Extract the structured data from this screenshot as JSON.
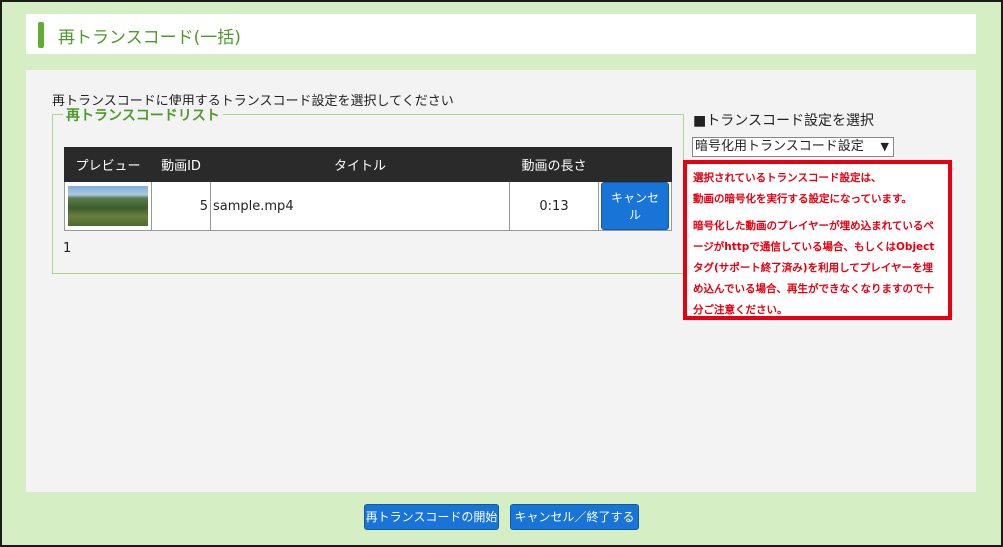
{
  "header": {
    "title": "再トランスコード(一括)"
  },
  "main": {
    "instruction": "再トランスコードに使用するトランスコード設定を選択してください",
    "list": {
      "legend": "再トランスコードリスト",
      "columns": [
        "プレビュー",
        "動画ID",
        "タイトル",
        "動画の長さ",
        ""
      ],
      "rows": [
        {
          "video_id": "5",
          "title": "sample.mp4",
          "duration": "0:13",
          "cancel_label": "キャンセル"
        }
      ],
      "pager": "1"
    },
    "settings": {
      "heading": "■トランスコード設定を選択",
      "selected": "暗号化用トランスコード設定",
      "arrow": "▼"
    },
    "warning": {
      "line1": "選択されているトランスコード設定は、",
      "line2": "動画の暗号化を実行する設定になっています。",
      "paragraph2": "暗号化した動画のプレイヤーが埋め込まれているページがhttpで通信している場合、もしくはObjectタグ(サポート終了済み)を利用してプレイヤーを埋め込んでいる場合、再生ができなくなりますので十分ご注意ください。"
    }
  },
  "footer": {
    "start_label": "再トランスコードの開始",
    "cancel_label": "キャンセル／終了する"
  },
  "colors": {
    "background": "#d6eec4",
    "accent_green": "#5fae32",
    "button_blue": "#1874d6",
    "warning_red": "#e60012"
  }
}
